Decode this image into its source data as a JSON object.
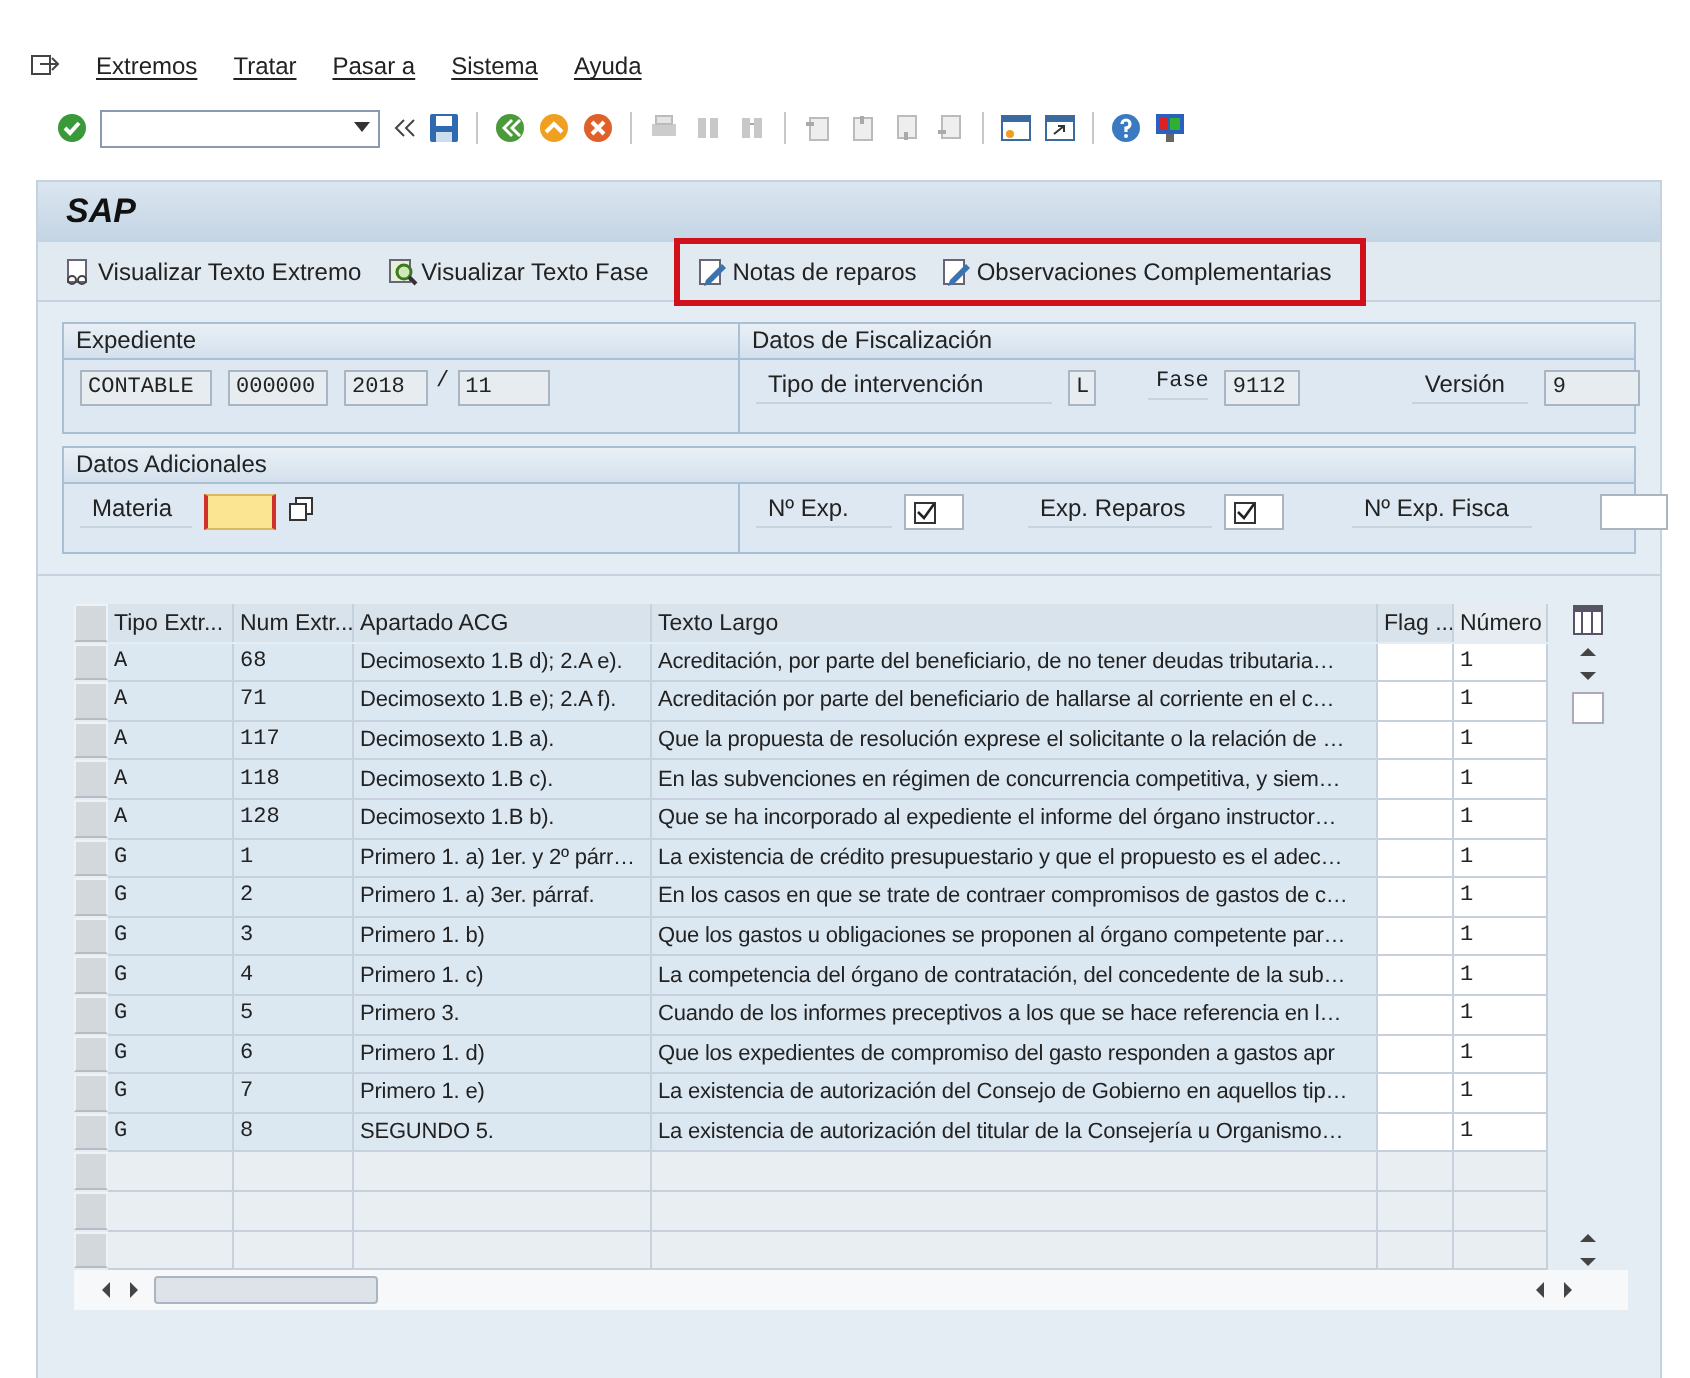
{
  "menu": [
    {
      "label": "Extremos"
    },
    {
      "label": "Tratar"
    },
    {
      "label": "Pasar a"
    },
    {
      "label": "Sistema"
    },
    {
      "label": "Ayuda"
    }
  ],
  "title": "SAP",
  "app_toolbar": [
    {
      "label": "Visualizar Texto Extremo",
      "highlighted": false
    },
    {
      "label": "Visualizar Texto Fase",
      "highlighted": false
    },
    {
      "label": "Notas de reparos",
      "highlighted": true
    },
    {
      "label": "Observaciones Complementarias",
      "highlighted": true
    }
  ],
  "expediente": {
    "title": "Expediente",
    "fields": [
      "CONTABLE",
      "000000",
      "2018"
    ],
    "separator": "/",
    "last": "11"
  },
  "fiscalizacion": {
    "title": "Datos de Fiscalización",
    "tipo_label": "Tipo de intervención",
    "tipo_value": "L",
    "fase_label": "Fase",
    "fase_value": "9112",
    "version_label": "Versión",
    "version_value": "9"
  },
  "adicionales": {
    "title": "Datos Adicionales",
    "materia_label": "Materia",
    "checks": [
      {
        "label": "Nº Exp.",
        "checked": true
      },
      {
        "label": "Exp. Reparos",
        "checked": true
      }
    ],
    "fisca_label": "Nº Exp. Fisca"
  },
  "table": {
    "columns": [
      "Tipo Extr...",
      "Num Extr...",
      "Apartado ACG",
      "Texto Largo",
      "Flag ...",
      "Número"
    ],
    "rows": [
      [
        "A",
        "68",
        "Decimosexto 1.B d); 2.A e).",
        "Acreditación, por parte del beneficiario, de no tener deudas tributaria…",
        "",
        "1"
      ],
      [
        "A",
        "71",
        "Decimosexto 1.B e); 2.A f).",
        "Acreditación por parte del beneficiario de hallarse al corriente en el c…",
        "",
        "1"
      ],
      [
        "A",
        "117",
        "Decimosexto 1.B a).",
        "Que la propuesta de resolución exprese el solicitante o la relación de …",
        "",
        "1"
      ],
      [
        "A",
        "118",
        "Decimosexto 1.B c).",
        "En las subvenciones en régimen de concurrencia competitiva, y siem…",
        "",
        "1"
      ],
      [
        "A",
        "128",
        "Decimosexto 1.B b).",
        "Que se ha incorporado al expediente el informe del órgano instructor…",
        "",
        "1"
      ],
      [
        "G",
        "1",
        "Primero 1. a) 1er. y 2º párr…",
        "La existencia de crédito presupuestario y que el propuesto es el adec…",
        "",
        "1"
      ],
      [
        "G",
        "2",
        "Primero 1. a) 3er. párraf.",
        "En los casos en que se trate de contraer compromisos de gastos de c…",
        "",
        "1"
      ],
      [
        "G",
        "3",
        "Primero 1. b)",
        "Que los gastos u obligaciones se proponen al órgano competente par…",
        "",
        "1"
      ],
      [
        "G",
        "4",
        "Primero 1. c)",
        "La competencia del órgano de contratación, del concedente de la sub…",
        "",
        "1"
      ],
      [
        "G",
        "5",
        "Primero 3.",
        "Cuando de los informes preceptivos a los que se hace referencia en l…",
        "",
        "1"
      ],
      [
        "G",
        "6",
        "Primero 1. d)",
        "Que los expedientes de compromiso del gasto responden a gastos apr",
        "",
        "1"
      ],
      [
        "G",
        "7",
        "Primero 1. e)",
        "La existencia de autorización del Consejo de Gobierno en aquellos tip…",
        "",
        "1"
      ],
      [
        "G",
        "8",
        "SEGUNDO 5.",
        "La existencia de autorización del titular de la Consejería u Organismo…",
        "",
        "1"
      ]
    ]
  }
}
